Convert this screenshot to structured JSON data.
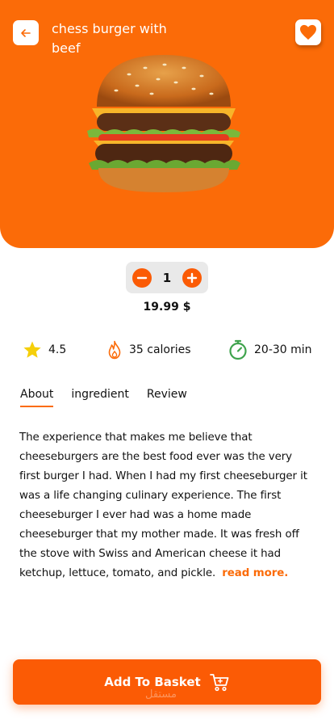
{
  "header": {
    "title": "chess burger with beef",
    "back_icon": "arrow-left-icon",
    "favorite_icon": "heart-icon"
  },
  "quantity": {
    "value": "1",
    "decrement_icon": "minus-icon",
    "increment_icon": "plus-icon"
  },
  "price": "19.99 $",
  "stats": {
    "rating": "4.5",
    "calories": "35 calories",
    "time": "20-30 min"
  },
  "tabs": [
    {
      "label": "About",
      "active": true
    },
    {
      "label": "ingredient",
      "active": false
    },
    {
      "label": "Review",
      "active": false
    }
  ],
  "description": {
    "text": "The experience that makes me believe that cheeseburgers are the best food ever was the very first burger I had. When I had my first cheeseburger it was a life changing culinary experience. The first cheeseburger I ever had was a home made cheeseburger that my mother made. It was fresh off the stove with Swiss and American cheese it had ketchup, lettuce, tomato, and pickle.",
    "read_more": "read more."
  },
  "cta": {
    "label": "Add To Basket",
    "icon": "cart-icon"
  },
  "watermark": "مستقل",
  "colors": {
    "accent": "#fb6b08",
    "button": "#fb5b05",
    "star": "#f5cf0a",
    "timer": "#3fa34d"
  }
}
